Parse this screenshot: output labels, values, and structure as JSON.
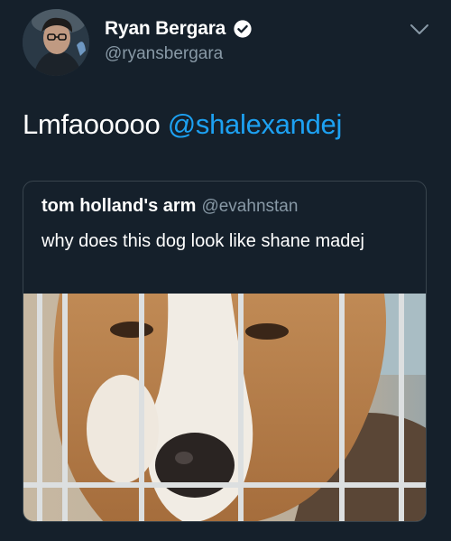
{
  "tweet": {
    "author_name": "Ryan Bergara",
    "author_handle": "@ryansbergara",
    "verified": true,
    "text": "Lmfaooooo ",
    "mention": "@shalexandej"
  },
  "quoted_tweet": {
    "author_name": "tom holland's arm",
    "author_handle": "@evahnstan",
    "text": "why does this dog look like shane madej"
  },
  "colors": {
    "background": "#15202b",
    "accent": "#1da1f2",
    "secondary_text": "#8899a6",
    "border": "#38444d"
  },
  "icons": {
    "verified": "verified-badge-icon",
    "menu": "chevron-down-icon"
  }
}
